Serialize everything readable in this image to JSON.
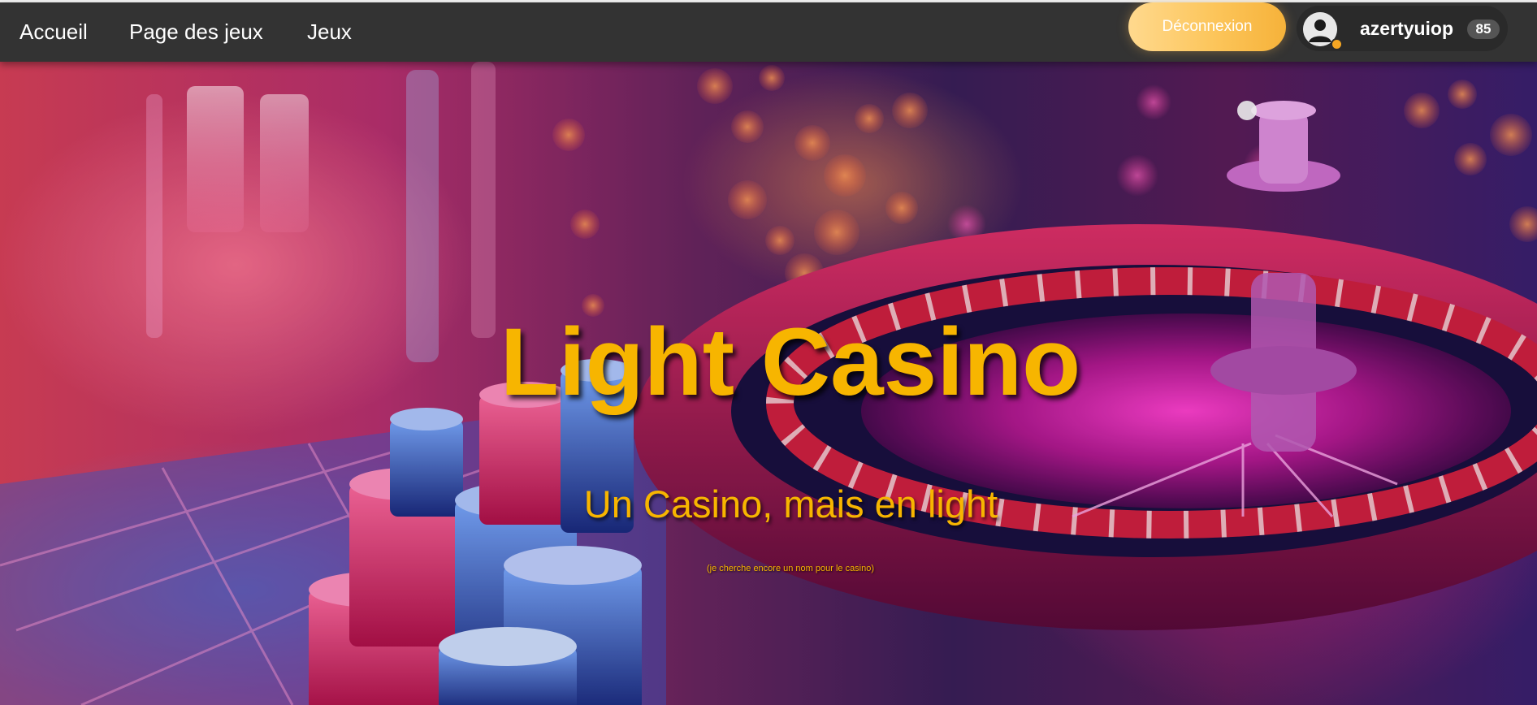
{
  "nav": {
    "links": [
      {
        "label": "Accueil"
      },
      {
        "label": "Page des jeux"
      },
      {
        "label": "Jeux"
      }
    ],
    "logout_label": "Déconnexion",
    "user": {
      "name": "azertyuiop",
      "count": "85"
    }
  },
  "hero": {
    "title": "Light Casino",
    "subtitle": "Un Casino, mais en light",
    "note": "(je cherche encore un nom pour le casino)"
  },
  "colors": {
    "navbar": "#333333",
    "accent_gold": "#f7b500",
    "logout_gradient_start": "#ffd98e",
    "logout_gradient_end": "#f6b23a"
  },
  "icons": {
    "avatar": "user-avatar-icon",
    "status": "status-dot-icon"
  }
}
